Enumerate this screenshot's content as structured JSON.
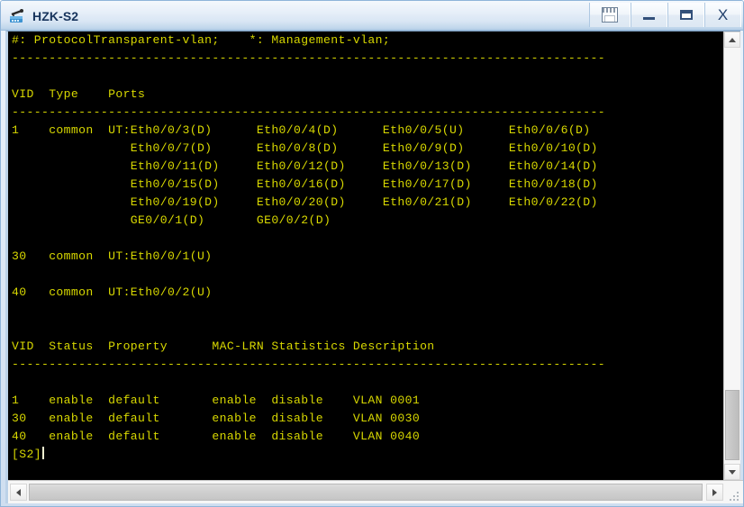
{
  "window": {
    "title": "HZK-S2",
    "app_icon": "network-switch-icon",
    "buttons": {
      "extra": "window-list",
      "minimize": "–",
      "maximize": "□",
      "close": "X"
    }
  },
  "terminal": {
    "foreground_color": "#d8d800",
    "background_color": "#000000",
    "lines": [
      "#: ProtocolTransparent-vlan;    *: Management-vlan;",
      "--------------------------------------------------------------------------------",
      "",
      "VID  Type    Ports",
      "--------------------------------------------------------------------------------",
      "1    common  UT:Eth0/0/3(D)      Eth0/0/4(D)      Eth0/0/5(U)      Eth0/0/6(D)",
      "                Eth0/0/7(D)      Eth0/0/8(D)      Eth0/0/9(D)      Eth0/0/10(D)",
      "                Eth0/0/11(D)     Eth0/0/12(D)     Eth0/0/13(D)     Eth0/0/14(D)",
      "                Eth0/0/15(D)     Eth0/0/16(D)     Eth0/0/17(D)     Eth0/0/18(D)",
      "                Eth0/0/19(D)     Eth0/0/20(D)     Eth0/0/21(D)     Eth0/0/22(D)",
      "                GE0/0/1(D)       GE0/0/2(D)",
      "",
      "30   common  UT:Eth0/0/1(U)",
      "",
      "40   common  UT:Eth0/0/2(U)",
      "",
      "",
      "VID  Status  Property      MAC-LRN Statistics Description",
      "--------------------------------------------------------------------------------",
      "",
      "1    enable  default       enable  disable    VLAN 0001",
      "30   enable  default       enable  disable    VLAN 0030",
      "40   enable  default       enable  disable    VLAN 0040"
    ],
    "prompt": "[S2]"
  },
  "scrollbars": {
    "vertical": {
      "up_arrow": "scroll-up",
      "down_arrow": "scroll-down",
      "thumb": "vertical-thumb"
    },
    "horizontal": {
      "left_arrow": "scroll-left",
      "right_arrow": "scroll-right",
      "thumb": "horizontal-thumb"
    }
  }
}
